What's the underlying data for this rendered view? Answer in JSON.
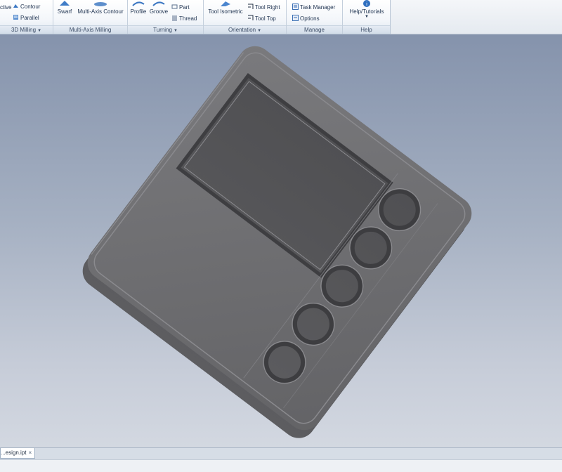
{
  "ribbon": {
    "panels": [
      {
        "title": "3D Milling",
        "buttons": [
          "ctive",
          "Contour",
          "Parallel"
        ]
      },
      {
        "title": "Multi-Axis Milling",
        "buttons": [
          "Swarf",
          "Multi-Axis Contour"
        ]
      },
      {
        "title": "Turning",
        "buttons": [
          "Profile",
          "Groove",
          "Part",
          "Thread"
        ]
      },
      {
        "title": "Orientation",
        "buttons": [
          "Tool Isometric",
          "Tool Right",
          "Tool Top"
        ]
      },
      {
        "title": "Manage",
        "buttons": [
          "Task Manager",
          "Options"
        ]
      },
      {
        "title": "Help",
        "buttons": [
          "Help/Tutorials"
        ]
      }
    ]
  },
  "document_tab": {
    "label": "...esign.ipt",
    "close": "×"
  },
  "colors": {
    "viewport_top": "#8593ac",
    "viewport_bottom": "#d3d8e1",
    "part": "#6f6f72",
    "ribbon_accent": "#2f6fbf"
  },
  "icons": [
    "contour-icon",
    "parallel-icon",
    "swarf-icon",
    "multi-axis-contour-icon",
    "profile-icon",
    "groove-icon",
    "part-icon",
    "thread-icon",
    "tool-isometric-icon",
    "tool-right-icon",
    "tool-top-icon",
    "task-manager-icon",
    "options-icon",
    "help-icon"
  ]
}
